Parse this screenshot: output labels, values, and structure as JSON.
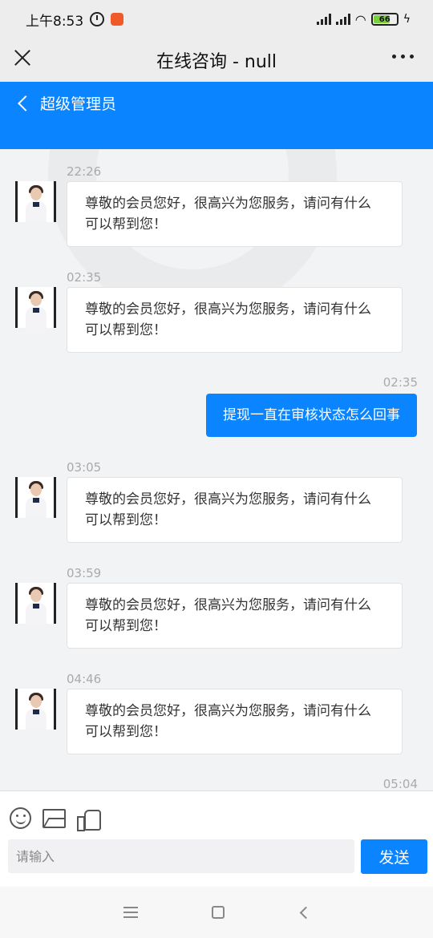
{
  "status_bar": {
    "time": "上午8:53",
    "battery": "66"
  },
  "title_bar": {
    "title": "在线咨询 - null"
  },
  "chat_header": {
    "title": "超级管理员"
  },
  "messages": [
    {
      "side": "left",
      "time": "22:26",
      "text": "尊敬的会员您好，很高兴为您服务，请问有什么可以帮到您！"
    },
    {
      "side": "left",
      "time": "02:35",
      "text": "尊敬的会员您好，很高兴为您服务，请问有什么可以帮到您！"
    },
    {
      "side": "right",
      "time": "02:35",
      "text": "提现一直在审核状态怎么回事"
    },
    {
      "side": "left",
      "time": "03:05",
      "text": "尊敬的会员您好，很高兴为您服务，请问有什么可以帮到您！"
    },
    {
      "side": "left",
      "time": "03:59",
      "text": "尊敬的会员您好，很高兴为您服务，请问有什么可以帮到您！"
    },
    {
      "side": "left",
      "time": "04:46",
      "text": "尊敬的会员您好，很高兴为您服务，请问有什么可以帮到您！"
    },
    {
      "side": "right",
      "time": "05:04",
      "text": ""
    }
  ],
  "input": {
    "placeholder": "请输入",
    "value": ""
  },
  "send_label": "发送",
  "icons": {
    "close": "close-icon",
    "more": "more-icon",
    "back": "back-icon",
    "emoji": "emoji-icon",
    "image": "image-icon",
    "like": "like-icon"
  },
  "colors": {
    "accent": "#0a84ff",
    "background": "#f2f3f5"
  }
}
